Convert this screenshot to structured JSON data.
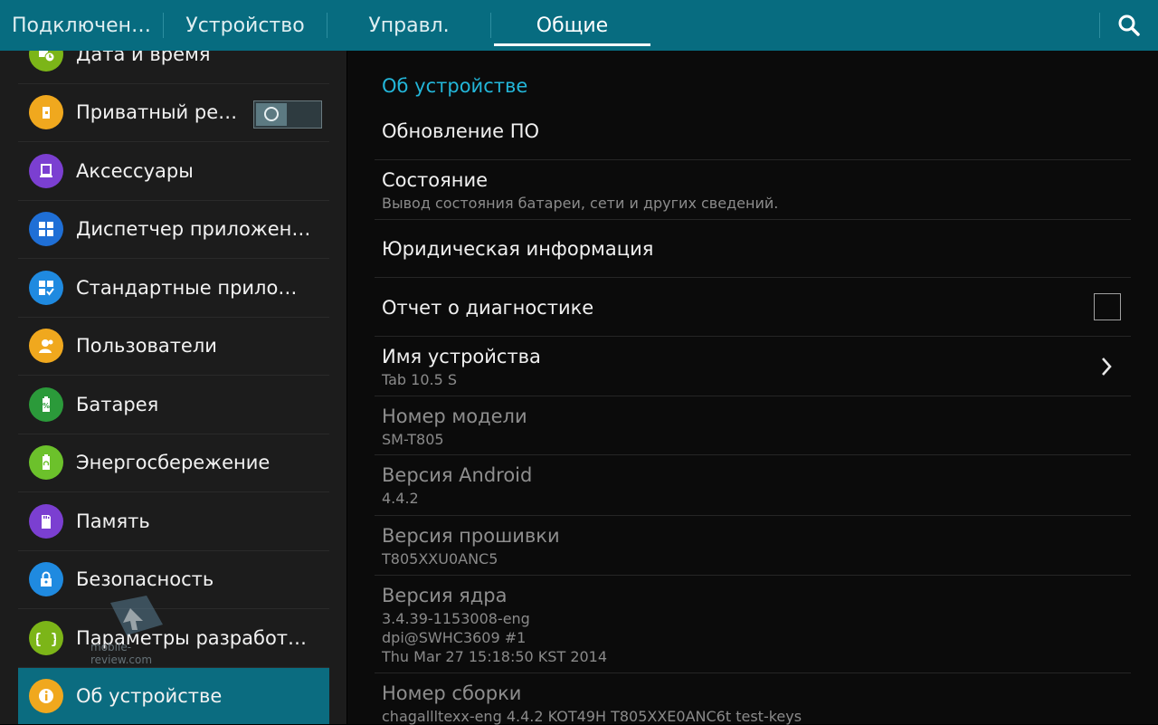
{
  "tabs": [
    {
      "label": "Подключен…"
    },
    {
      "label": "Устройство"
    },
    {
      "label": "Управл."
    },
    {
      "label": "Общие"
    }
  ],
  "active_tab": "Общие",
  "sidebar": {
    "items": [
      {
        "label": "Дата и время",
        "icon": "calendar-clock-icon",
        "color": "#7cb518"
      },
      {
        "label": "Приватный реж…",
        "icon": "private-mode-icon",
        "color": "#f0a81e"
      },
      {
        "label": "Аксессуары",
        "icon": "accessory-icon",
        "color": "#7b3fd1"
      },
      {
        "label": "Диспетчер приложений",
        "icon": "app-grid-icon",
        "color": "#1f6fd6"
      },
      {
        "label": "Стандартные приложен…",
        "icon": "default-apps-icon",
        "color": "#1f8ae0"
      },
      {
        "label": "Пользователи",
        "icon": "users-icon",
        "color": "#f0a81e"
      },
      {
        "label": "Батарея",
        "icon": "battery-icon",
        "color": "#2b9a3a"
      },
      {
        "label": "Энергосбережение",
        "icon": "power-saving-icon",
        "color": "#6cc12b"
      },
      {
        "label": "Память",
        "icon": "storage-icon",
        "color": "#7b3fd1"
      },
      {
        "label": "Безопасность",
        "icon": "lock-icon",
        "color": "#1f8ae0"
      },
      {
        "label": "Параметры разработчика",
        "icon": "braces-icon",
        "color": "#7cb518"
      },
      {
        "label": "Об устройстве",
        "icon": "info-icon",
        "color": "#f0a81e"
      }
    ],
    "active_index": 11,
    "toggle_state": "off"
  },
  "watermark": "mobile-review.com",
  "content": {
    "section_title": "Об устройстве",
    "rows": [
      {
        "title": "Обновление ПО"
      },
      {
        "title": "Состояние",
        "sub": "Вывод состояния батареи, сети и других сведений."
      },
      {
        "title": "Юридическая информация"
      },
      {
        "title": "Отчет о диагностике",
        "checked": false
      },
      {
        "title": "Имя устройства",
        "sub": "Tab 10.5 S"
      },
      {
        "title": "Номер модели",
        "sub": "SM-T805"
      },
      {
        "title": "Версия Android",
        "sub": "4.4.2"
      },
      {
        "title": "Версия прошивки",
        "sub": "T805XXU0ANC5"
      },
      {
        "title": "Версия ядра",
        "sub_lines": [
          "3.4.39-1153008-eng",
          "dpi@SWHC3609 #1",
          "Thu Mar 27 15:18:50 KST 2014"
        ]
      },
      {
        "title": "Номер сборки",
        "sub": "chagallltexx-eng 4.4.2 KOT49H T805XXE0ANC6t test-keys"
      }
    ]
  },
  "colors": {
    "accent": "#076c80",
    "section_title": "#23b6d9",
    "active_item": "#0b6c80"
  }
}
